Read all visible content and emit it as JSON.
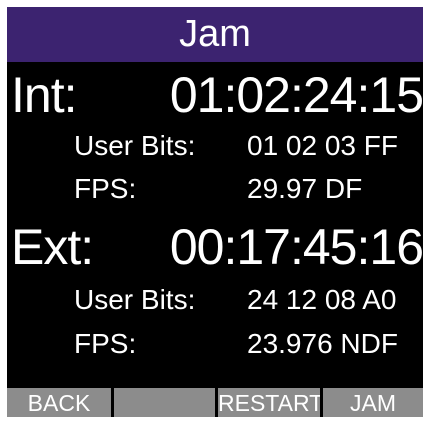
{
  "header": {
    "title": "Jam"
  },
  "internal": {
    "label": "Int:",
    "timecode": "01:02:24:15",
    "user_bits_label": "User Bits:",
    "user_bits_value": "01 02 03 FF",
    "fps_label": "FPS:",
    "fps_value": "29.97 DF"
  },
  "external": {
    "label": "Ext:",
    "timecode": "00:17:45:16",
    "user_bits_label": "User Bits:",
    "user_bits_value": "24 12 08 A0",
    "fps_label": "FPS:",
    "fps_value": "23.976 NDF"
  },
  "softkeys": {
    "key1": "BACK",
    "key2": "",
    "key3": "RESTART",
    "key4": "JAM"
  },
  "colors": {
    "title_bar": "#3c2370",
    "screen_bg": "#000000",
    "softkey_bg": "#8c8c8c",
    "text": "#ffffff"
  }
}
